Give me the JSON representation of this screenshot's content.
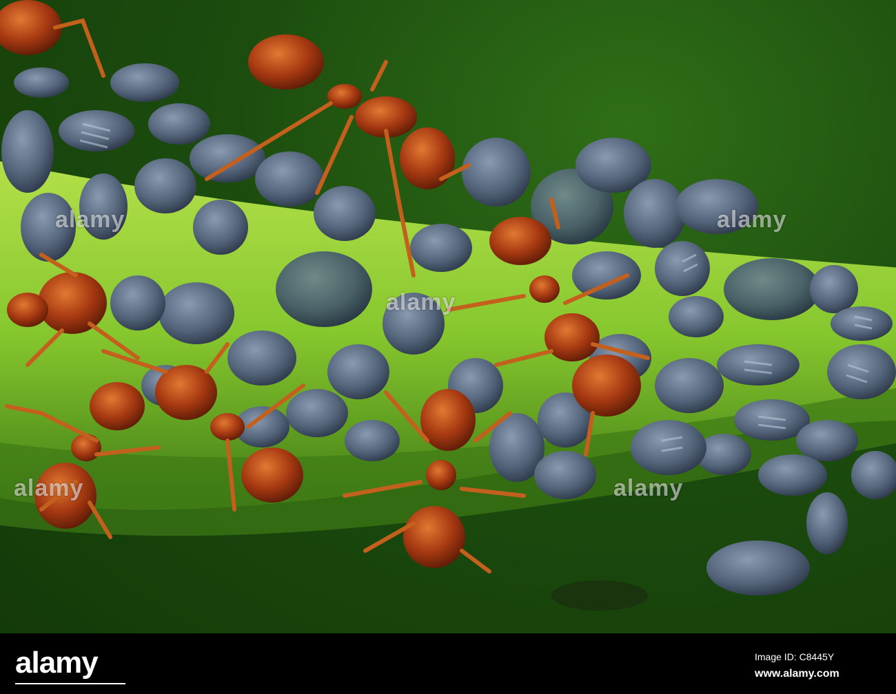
{
  "watermark": {
    "text": "alamy"
  },
  "footer": {
    "logo": "alamy",
    "image_id": "Image ID: C8445Y",
    "url": "www.alamy.com"
  },
  "colors": {
    "background_green": "#1c4c0e",
    "stem_green": "#7fbf2a",
    "aphid_blue_gray": "#56677e",
    "ant_red_brown": "#a83a12",
    "footer_black": "#000000"
  }
}
